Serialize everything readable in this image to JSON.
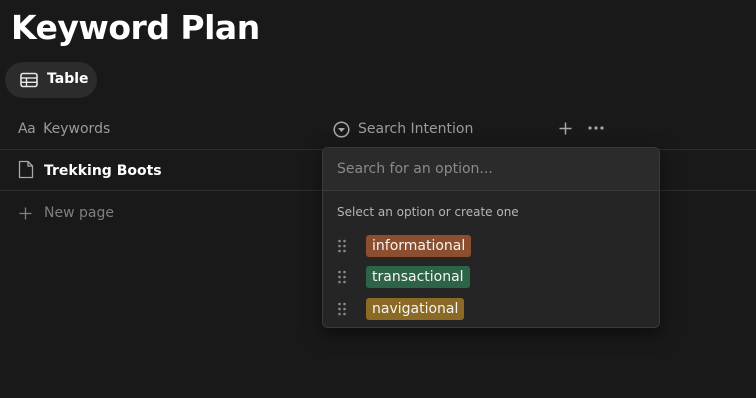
{
  "page": {
    "title": "Keyword Plan"
  },
  "view_tab": {
    "label": "Table",
    "icon": "table-icon"
  },
  "columns": [
    {
      "label": "Keywords",
      "icon": "text-property-icon"
    },
    {
      "label": "Search Intention",
      "icon": "select-property-icon"
    }
  ],
  "header_actions": {
    "add_icon": "plus-icon",
    "more_icon": "ellipsis-icon"
  },
  "rows": [
    {
      "name": "Trekking Boots",
      "icon": "page-icon"
    }
  ],
  "new_page": {
    "label": "New page",
    "icon": "plus-icon"
  },
  "dropdown": {
    "search_placeholder": "Search for an option...",
    "hint": "Select an option or create one",
    "options": [
      {
        "label": "informational",
        "color": "#8b4e2e"
      },
      {
        "label": "transactional",
        "color": "#2d6448"
      },
      {
        "label": "navigational",
        "color": "#8a6a25"
      }
    ]
  },
  "colors": {
    "background": "#191919",
    "title": "#ffffff",
    "muted": "#9b9b9b"
  }
}
